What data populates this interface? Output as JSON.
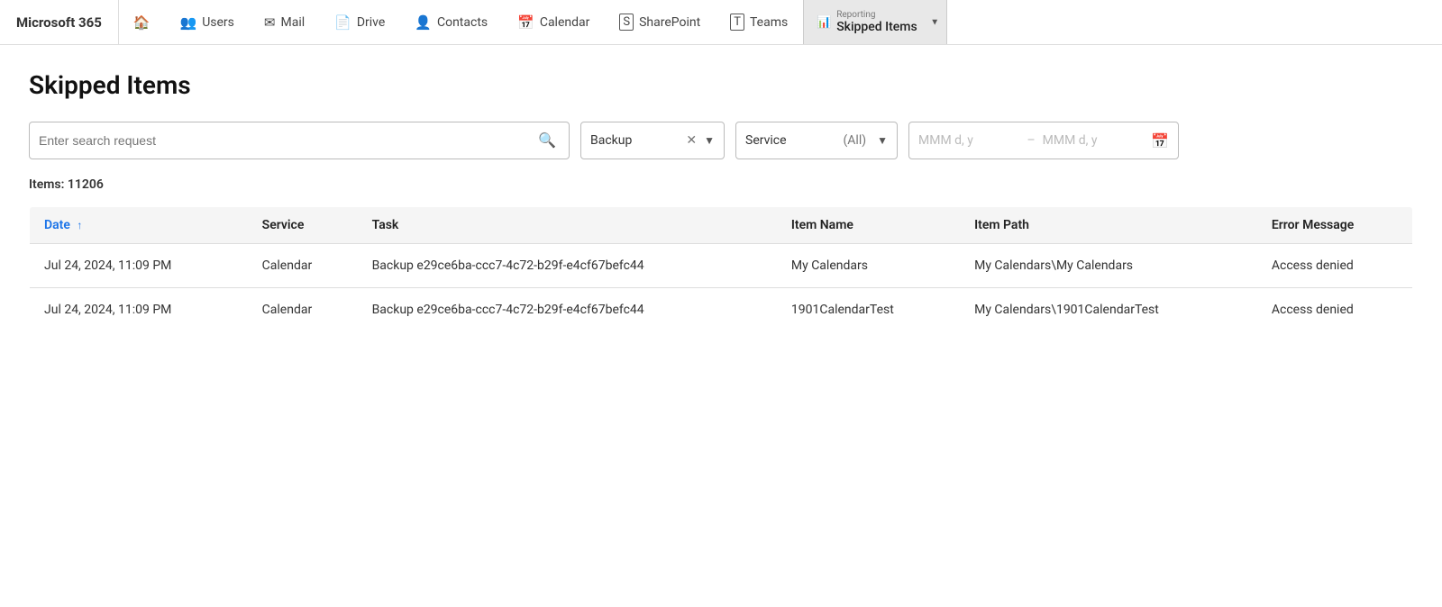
{
  "brand": "Microsoft 365",
  "nav": {
    "items": [
      {
        "id": "home",
        "label": "",
        "icon": "🏠"
      },
      {
        "id": "users",
        "label": "Users",
        "icon": "👥"
      },
      {
        "id": "mail",
        "label": "Mail",
        "icon": "✉"
      },
      {
        "id": "drive",
        "label": "Drive",
        "icon": "📄"
      },
      {
        "id": "contacts",
        "label": "Contacts",
        "icon": "👤"
      },
      {
        "id": "calendar",
        "label": "Calendar",
        "icon": "📅"
      },
      {
        "id": "sharepoint",
        "label": "SharePoint",
        "icon": "🅂"
      },
      {
        "id": "teams",
        "label": "Teams",
        "icon": "🅃"
      }
    ],
    "active": {
      "sub_label": "Reporting",
      "main_label": "Skipped Items"
    }
  },
  "page": {
    "title": "Skipped Items"
  },
  "filters": {
    "search_placeholder": "Enter search request",
    "backup_label": "Backup",
    "service_label": "Service",
    "service_value": "(All)",
    "date_placeholder_start": "MMM d, y",
    "date_placeholder_end": "MMM d, y"
  },
  "items_count_label": "Items: 11206",
  "table": {
    "columns": [
      {
        "id": "date",
        "label": "Date",
        "sortable": true,
        "sort_dir": "asc"
      },
      {
        "id": "service",
        "label": "Service",
        "sortable": false
      },
      {
        "id": "task",
        "label": "Task",
        "sortable": false
      },
      {
        "id": "item_name",
        "label": "Item Name",
        "sortable": false
      },
      {
        "id": "item_path",
        "label": "Item Path",
        "sortable": false
      },
      {
        "id": "error_message",
        "label": "Error Message",
        "sortable": false
      }
    ],
    "rows": [
      {
        "date": "Jul 24, 2024, 11:09 PM",
        "service": "Calendar",
        "task": "Backup e29ce6ba-ccc7-4c72-b29f-e4cf67befc44",
        "item_name": "My Calendars",
        "item_path": "My Calendars\\My Calendars",
        "error_message": "Access denied"
      },
      {
        "date": "Jul 24, 2024, 11:09 PM",
        "service": "Calendar",
        "task": "Backup e29ce6ba-ccc7-4c72-b29f-e4cf67befc44",
        "item_name": "1901CalendarTest",
        "item_path": "My Calendars\\1901CalendarTest",
        "error_message": "Access denied"
      }
    ]
  }
}
